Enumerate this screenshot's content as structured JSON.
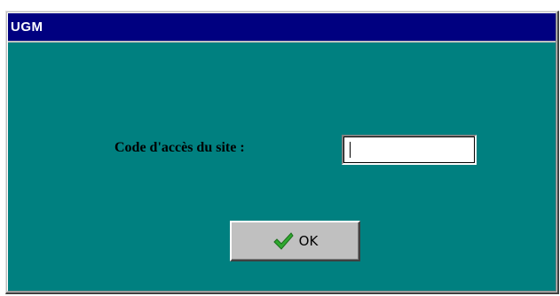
{
  "window": {
    "title": "UGM"
  },
  "form": {
    "field_label": "Code d'accès du site :",
    "code_value": ""
  },
  "ok_button": {
    "label": "OK",
    "icon": "checkmark-icon"
  },
  "colors": {
    "titlebar": "#000080",
    "client_background": "#008080",
    "button_face": "#c0c0c0",
    "check_green": "#2fa82f"
  }
}
